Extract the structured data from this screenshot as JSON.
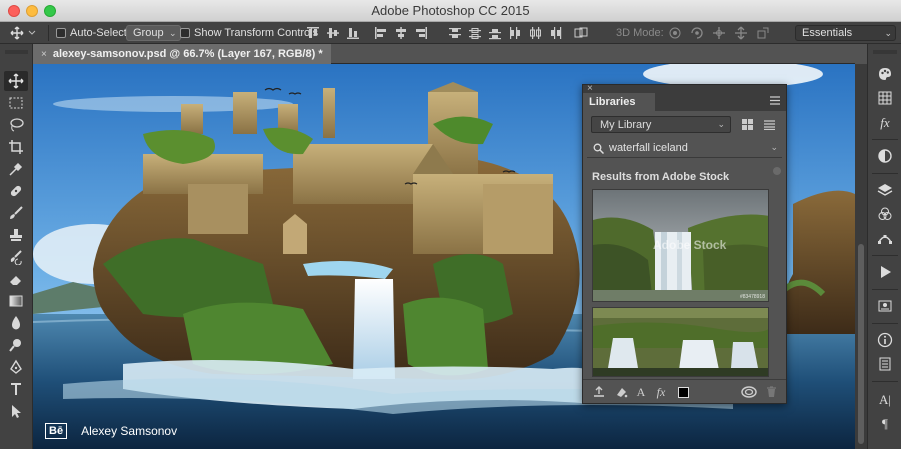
{
  "window": {
    "title": "Adobe Photoshop CC 2015"
  },
  "options_bar": {
    "auto_select_label": "Auto-Select:",
    "auto_select_checked": false,
    "group_select": "Group",
    "show_transform_label": "Show Transform Controls",
    "show_transform_checked": false,
    "mode_3d_label": "3D Mode:",
    "workspace": "Essentials"
  },
  "document": {
    "tab_title": "alexey-samsonov.psd @ 66.7% (Layer 167, RGB/8) *"
  },
  "tools": [
    "move-tool",
    "marquee-tool",
    "lasso-tool",
    "crop-tool",
    "eyedropper-tool",
    "healing-brush-tool",
    "brush-tool",
    "clone-stamp-tool",
    "history-brush-tool",
    "eraser-tool",
    "gradient-tool",
    "blur-tool",
    "dodge-tool",
    "pen-tool",
    "type-tool",
    "path-selection-tool"
  ],
  "canvas": {
    "credit_logo": "Bē",
    "credit_name": "Alexey Samsonov"
  },
  "libraries": {
    "tab": "Libraries",
    "close": "×",
    "library_name": "My Library",
    "search_query": "waterfall iceland",
    "results_heading": "Results from Adobe Stock",
    "watermark": "Adobe Stock",
    "watermark_id": "#83478918"
  },
  "right_panel_icons": [
    "color-icon",
    "swatches-icon",
    "adjustments-icon",
    "styles-icon",
    "layers-icon",
    "channels-icon",
    "paths-icon",
    "actions-icon",
    "properties-icon",
    "info-icon",
    "history-icon",
    "character-icon",
    "paragraph-icon"
  ]
}
